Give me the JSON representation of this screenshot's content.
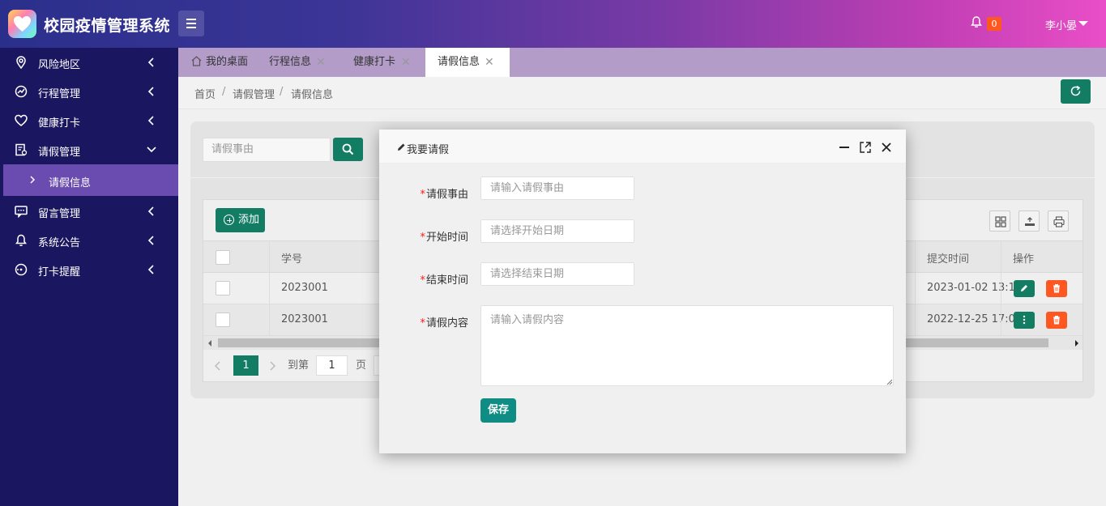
{
  "app": {
    "title": "校园疫情管理系统"
  },
  "header": {
    "notification_count": "0",
    "user_name": "李小晏"
  },
  "sidebar": {
    "items": [
      {
        "label": "风险地区",
        "icon": "location-icon"
      },
      {
        "label": "行程管理",
        "icon": "trend-icon"
      },
      {
        "label": "健康打卡",
        "icon": "heart-icon"
      },
      {
        "label": "请假管理",
        "icon": "document-icon"
      },
      {
        "label": "留言管理",
        "icon": "message-icon"
      },
      {
        "label": "系统公告",
        "icon": "bell-icon"
      },
      {
        "label": "打卡提醒",
        "icon": "clock-icon"
      }
    ],
    "sub_item": {
      "label": "请假信息"
    }
  },
  "tabs": [
    {
      "label": "我的桌面"
    },
    {
      "label": "行程信息"
    },
    {
      "label": "健康打卡"
    },
    {
      "label": "请假信息"
    }
  ],
  "breadcrumb": [
    "首页",
    "请假管理",
    "请假信息"
  ],
  "search": {
    "placeholder": "请假事由"
  },
  "toolbar": {
    "add_label": "添加"
  },
  "table": {
    "headers": {
      "student_id": "学号",
      "submit_time": "提交时间",
      "actions": "操作"
    },
    "rows": [
      {
        "student_id": "2023001",
        "submit_time": "2023-01-02 13:1..."
      },
      {
        "student_id": "2023001",
        "submit_time": "2022-12-25 17:0..."
      }
    ]
  },
  "pager": {
    "current": "1",
    "goto_label": "到第",
    "goto_value": "1",
    "page_label": "页"
  },
  "modal": {
    "title": "我要请假",
    "fields": [
      {
        "label": "请假事由",
        "placeholder": "请输入请假事由"
      },
      {
        "label": "开始时间",
        "placeholder": "请选择开始日期"
      },
      {
        "label": "结束时间",
        "placeholder": "请选择结束日期"
      },
      {
        "label": "请假内容",
        "placeholder": "请输入请假内容"
      }
    ],
    "save_label": "保存"
  },
  "colors": {
    "primary": "#137d64",
    "danger": "#ff5722",
    "sidebar": "#1b1660",
    "sidebar_active": "#6a4bb0"
  }
}
